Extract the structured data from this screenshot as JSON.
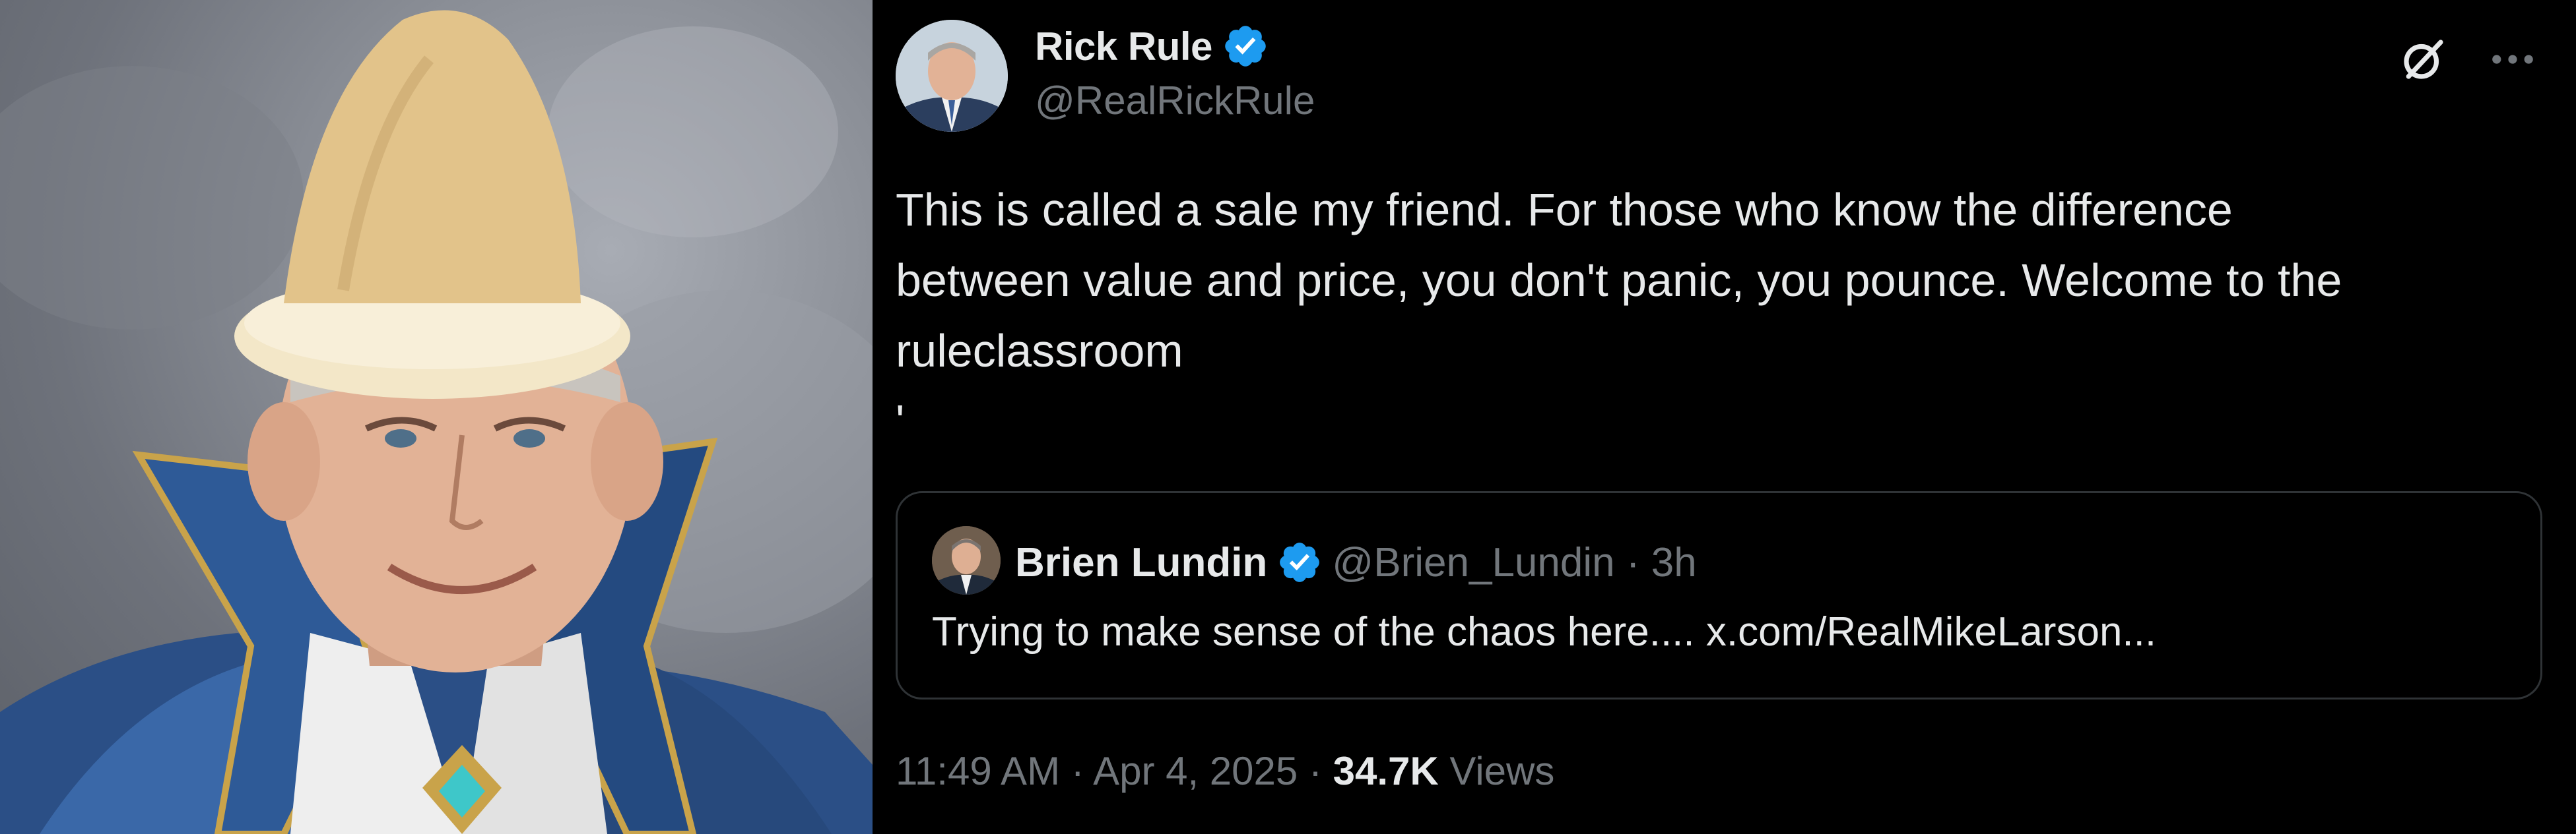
{
  "portrait": {
    "description_icon": "portrait-image"
  },
  "tweet": {
    "author": {
      "name": "Rick Rule",
      "handle": "@RealRickRule",
      "verified_icon": "verified-badge-icon"
    },
    "body": "This is called a sale my friend. For those who know the difference\nbetween value and price, you don't panic, you pounce. Welcome to the\nruleclassroom\n'",
    "quoted": {
      "name": "Brien Lundin",
      "meta": "@Brien_Lundin · 3h",
      "text": "Trying to make sense of the chaos here.... x.com/RealMikeLarson..."
    },
    "footer": {
      "time_date": "11:49 AM · Apr 4, 2025 · ",
      "views_count": "34.7K",
      "views_label": " Views"
    },
    "icons": {
      "grok": "grok-icon",
      "more": "more-icon"
    }
  },
  "colors": {
    "background": "#000000",
    "text_primary": "#e7e9ea",
    "text_secondary": "#71767b",
    "verified_blue": "#1d9bf0",
    "border": "#2f3336"
  }
}
